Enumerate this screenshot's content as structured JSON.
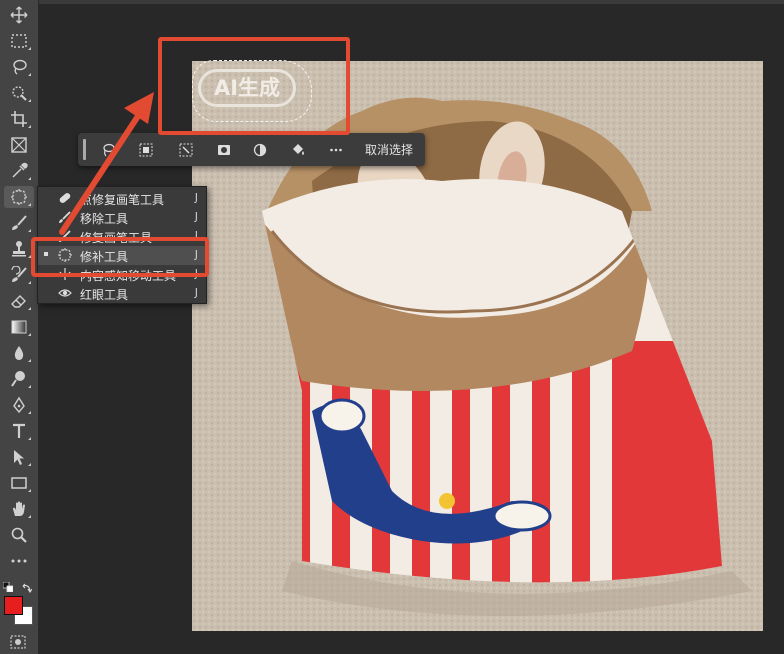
{
  "toolbar": {
    "tools": [
      {
        "name": "move-tool",
        "icon": "move-icon"
      },
      {
        "name": "marquee-tool",
        "icon": "rect-marquee-icon"
      },
      {
        "name": "lasso-tool",
        "icon": "lasso-icon"
      },
      {
        "name": "quick-select-tool",
        "icon": "quick-select-icon"
      },
      {
        "name": "crop-tool",
        "icon": "crop-icon"
      },
      {
        "name": "frame-tool",
        "icon": "frame-icon"
      },
      {
        "name": "eyedropper-tool",
        "icon": "eyedropper-icon"
      },
      {
        "name": "healing-tool",
        "icon": "patch-icon"
      },
      {
        "name": "brush-tool",
        "icon": "brush-icon"
      },
      {
        "name": "stamp-tool",
        "icon": "stamp-icon"
      },
      {
        "name": "history-brush-tool",
        "icon": "history-brush-icon"
      },
      {
        "name": "eraser-tool",
        "icon": "eraser-icon"
      },
      {
        "name": "gradient-tool",
        "icon": "gradient-icon"
      },
      {
        "name": "blur-tool",
        "icon": "blur-drop-icon"
      },
      {
        "name": "dodge-tool",
        "icon": "dodge-icon"
      },
      {
        "name": "pen-tool",
        "icon": "pen-icon"
      },
      {
        "name": "type-tool",
        "icon": "type-icon"
      },
      {
        "name": "path-select-tool",
        "icon": "arrow-select-icon"
      },
      {
        "name": "shape-tool",
        "icon": "rectangle-icon"
      },
      {
        "name": "hand-tool",
        "icon": "hand-icon"
      },
      {
        "name": "zoom-tool",
        "icon": "zoom-icon"
      },
      {
        "name": "more-tools",
        "icon": "more-icon"
      }
    ],
    "foreground_color": "#e61e1e",
    "background_color": "#ffffff"
  },
  "context_bar": {
    "deselect_label": "取消选择"
  },
  "flyout": {
    "items": [
      {
        "label": "点修复画笔工具",
        "shortcut": "J",
        "icon": "spot-healing-icon",
        "selected": false
      },
      {
        "label": "移除工具",
        "shortcut": "J",
        "icon": "remove-icon",
        "selected": false
      },
      {
        "label": "修复画笔工具",
        "shortcut": "J",
        "icon": "healing-brush-icon",
        "selected": false
      },
      {
        "label": "修补工具",
        "shortcut": "J",
        "icon": "patch-icon",
        "selected": true
      },
      {
        "label": "内容感知移动工具",
        "shortcut": "J",
        "icon": "content-aware-move-icon",
        "selected": false
      },
      {
        "label": "红眼工具",
        "shortcut": "J",
        "icon": "red-eye-icon",
        "selected": false
      }
    ]
  },
  "canvas": {
    "watermark_text": "AI生成"
  },
  "annotation": {
    "highlight_color": "#e24b32"
  }
}
